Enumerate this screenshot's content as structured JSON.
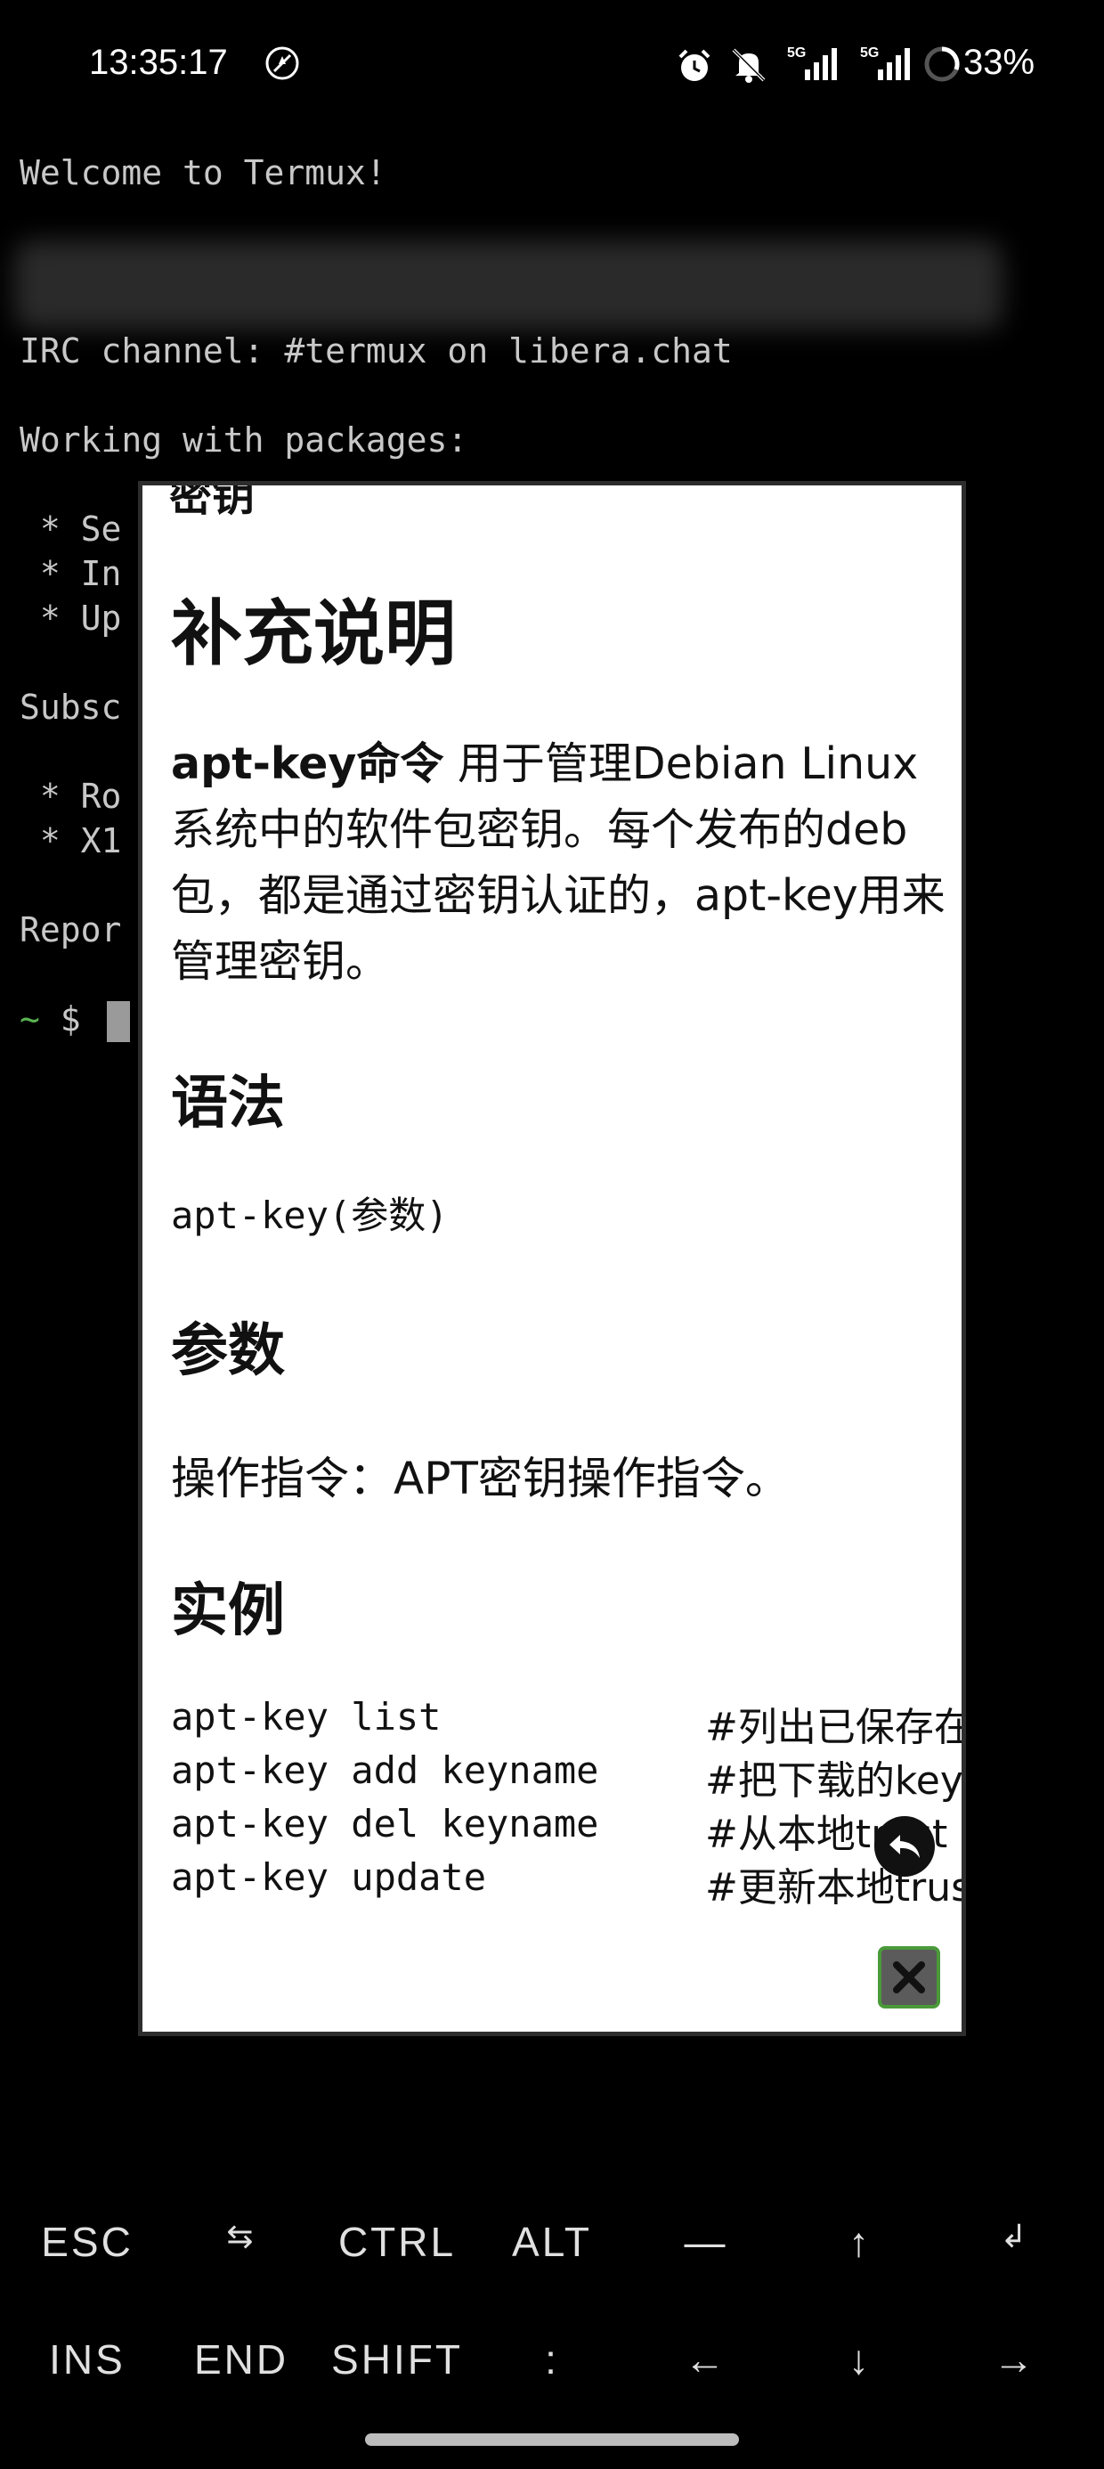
{
  "status_bar": {
    "time": "13:35:17",
    "battery": "33%",
    "icons": [
      "no-location-icon",
      "alarm-icon",
      "mute-icon",
      "5g-signal-icon",
      "5g-signal-icon",
      "battery-icon"
    ]
  },
  "terminal": {
    "welcome": "Welcome to Termux!",
    "irc": "IRC channel: #termux on libera.chat",
    "packages_heading": "Working with packages:",
    "pkg_lines": [
      " * Se",
      " * In",
      " * Up"
    ],
    "subscribe": "Subsc",
    "sub_lines": [
      " * Ro",
      " * X1"
    ],
    "report": "Repor",
    "prompt_tilde": "~",
    "prompt_dollar": " $ "
  },
  "dialog": {
    "cut_text": "密钥",
    "title": "补充说明",
    "intro_bold": "apt-key命令",
    "intro_rest": " 用于管理Debian Linux系统中的软件包密钥。每个发布的deb包，都是通过密钥认证的，apt-key用来管理密钥。",
    "syntax_heading": "语法",
    "syntax_code": "apt-key(参数)",
    "params_heading": "参数",
    "params_text": "操作指令：APT密钥操作指令。",
    "examples_heading": "实例",
    "examples": [
      {
        "cmd": "apt-key list",
        "comment": "#列出已保存在"
      },
      {
        "cmd": "apt-key add keyname",
        "comment": "#把下载的key"
      },
      {
        "cmd": "apt-key del keyname",
        "comment": "#从本地trust"
      },
      {
        "cmd": "apt-key update",
        "comment": "#更新本地trus"
      }
    ]
  },
  "extra_keys": {
    "row1": [
      "ESC",
      "⇆",
      "CTRL",
      "ALT",
      "—",
      "↑",
      "↲"
    ],
    "row2": [
      "INS",
      "END",
      "SHIFT",
      ":",
      "←",
      "↓",
      "→"
    ]
  },
  "colors": {
    "background": "#000000",
    "terminal_text": "#c8c8c8",
    "prompt_green": "#5ab552",
    "dialog_bg": "#ffffff",
    "close_border": "#4a9a3a"
  }
}
